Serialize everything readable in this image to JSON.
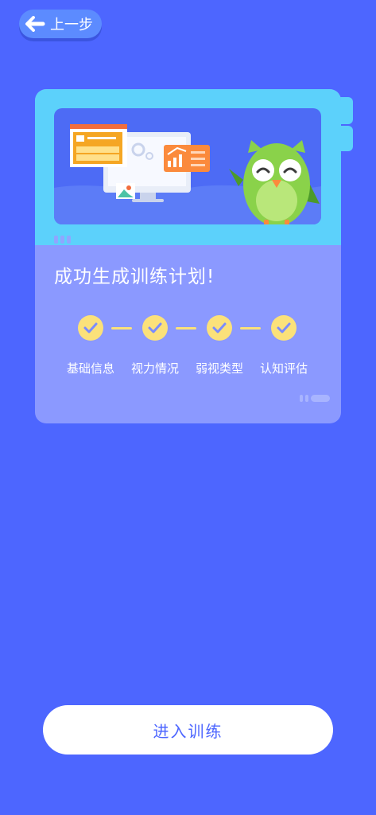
{
  "header": {
    "back_label": "上一步"
  },
  "card": {
    "title": "成功生成训练计划!",
    "steps": [
      {
        "label": "基础信息",
        "done": true
      },
      {
        "label": "视力情况",
        "done": true
      },
      {
        "label": "弱视类型",
        "done": true
      },
      {
        "label": "认知评估",
        "done": true
      }
    ]
  },
  "footer": {
    "enter_label": "进入训练"
  },
  "colors": {
    "background": "#4d66ff",
    "card": "#8b99ff",
    "card_top": "#5cd1fb",
    "step_accent": "#fbe17a",
    "owl_green": "#8ad24a"
  }
}
